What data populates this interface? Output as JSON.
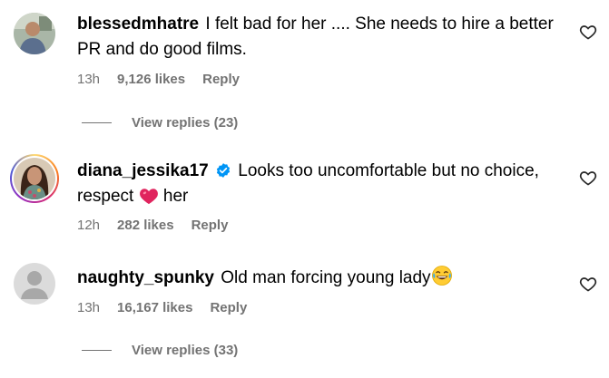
{
  "comments": [
    {
      "username": "blessedmhatre",
      "text": "I felt bad for her .... She needs to hire a better PR and do good films.",
      "time": "13h",
      "likes": "9,126 likes",
      "reply_label": "Reply",
      "view_replies": "View replies (23)"
    },
    {
      "username": "diana_jessika17",
      "verified": true,
      "text_before": "Looks too uncomfortable but no choice, respect",
      "text_after": "her",
      "time": "12h",
      "likes": "282 likes",
      "reply_label": "Reply"
    },
    {
      "username": "naughty_spunky",
      "text": "Old man forcing young lady",
      "time": "13h",
      "likes": "16,167 likes",
      "reply_label": "Reply",
      "view_replies": "View replies (33)"
    }
  ],
  "icons": {
    "like": "heart-outline-icon",
    "verified": "verified-badge-icon",
    "red_heart_emoji": "red-heart-emoji",
    "laughing_emoji": "tears-of-joy-emoji"
  },
  "colors": {
    "text": "#000000",
    "meta": "#737373",
    "verified": "#0095f6",
    "red_heart": "#e0245e"
  }
}
